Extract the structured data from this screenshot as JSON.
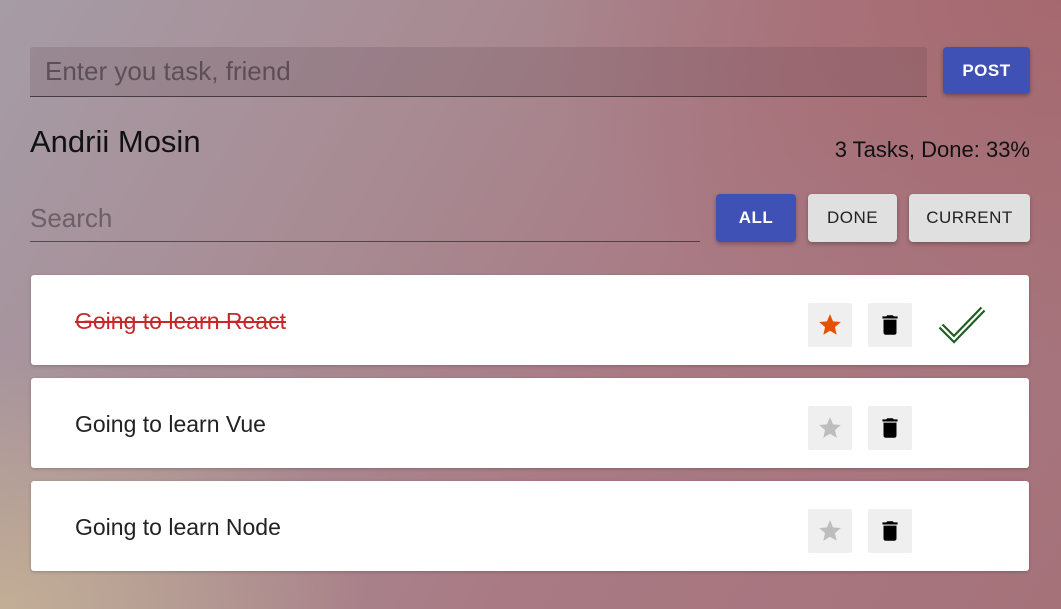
{
  "new_task": {
    "placeholder": "Enter you task, friend",
    "post_label": "POST"
  },
  "header": {
    "user_name": "Andrii Mosin",
    "stats": "3 Tasks, Done: 33%"
  },
  "search": {
    "placeholder": "Search"
  },
  "filters": {
    "all_label": "ALL",
    "done_label": "DONE",
    "current_label": "CURRENT",
    "active": "ALL"
  },
  "tasks": [
    {
      "text": "Going to learn React",
      "done": true,
      "starred": true,
      "icons": [
        "star-icon",
        "trash-icon",
        "checkmark-icon"
      ]
    },
    {
      "text": "Going to learn Vue",
      "done": false,
      "starred": false,
      "icons": [
        "star-icon",
        "trash-icon"
      ]
    },
    {
      "text": "Going to learn Node",
      "done": false,
      "starred": false,
      "icons": [
        "star-icon",
        "trash-icon"
      ]
    }
  ],
  "colors": {
    "primary": "#3f51b5",
    "done_text": "#c62828",
    "star_active": "#e65100",
    "star_inactive": "#bdbdbd",
    "check": "#1b5e20"
  }
}
